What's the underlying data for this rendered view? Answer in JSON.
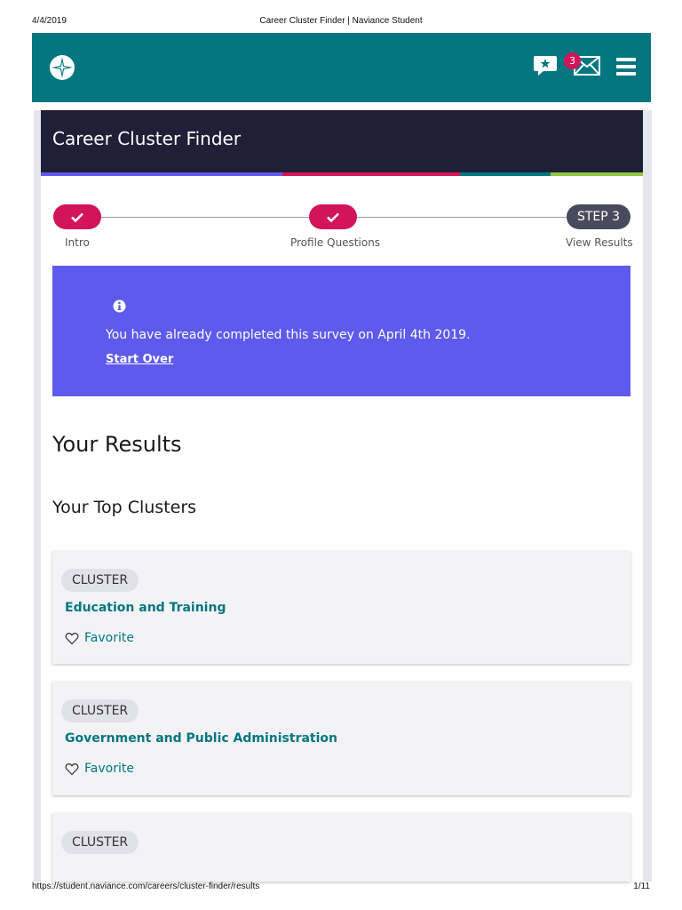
{
  "print": {
    "date": "4/4/2019",
    "page_title": "Career Cluster Finder | Naviance Student",
    "url": "https://student.naviance.com/careers/cluster-finder/results",
    "page_number": "1/11"
  },
  "topbar": {
    "logo_icon": "compass-star-logo",
    "chat_icon": "chat-star-icon",
    "mail_icon": "envelope-icon",
    "mail_badge": "3",
    "menu_icon": "hamburger-menu-icon",
    "color": "#037680"
  },
  "page": {
    "title": "Career Cluster Finder",
    "stripe_colors": [
      "#5e5aed",
      "#d3145a",
      "#037680",
      "#8dc63f"
    ]
  },
  "stepper": {
    "steps": [
      {
        "label": "Intro",
        "state": "complete"
      },
      {
        "label": "Profile Questions",
        "state": "complete"
      },
      {
        "label": "View Results",
        "state": "current",
        "pill_text": "STEP 3"
      }
    ],
    "accent": "#d3145a"
  },
  "alert": {
    "icon": "info-icon",
    "message": "You have already completed this survey on April 4th 2019.",
    "link": "Start Over",
    "color": "#5e5aed"
  },
  "results": {
    "heading": "Your Results",
    "subheading": "Your Top Clusters",
    "clusters": [
      {
        "badge": "CLUSTER",
        "name": "Education and Training",
        "favorite_label": "Favorite"
      },
      {
        "badge": "CLUSTER",
        "name": "Government and Public Administration",
        "favorite_label": "Favorite"
      },
      {
        "badge": "CLUSTER",
        "name": "",
        "favorite_label": ""
      }
    ]
  }
}
